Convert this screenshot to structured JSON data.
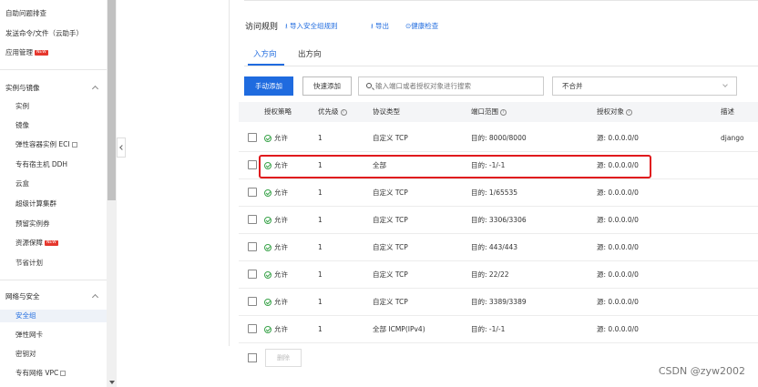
{
  "sidebar": {
    "items": [
      {
        "label": "自助问题排查"
      },
      {
        "label": "发送命令/文件（云助手）"
      },
      {
        "label": "应用管理",
        "badge": "NEW"
      }
    ],
    "groups": [
      {
        "label": "实例与镜像",
        "items": [
          {
            "label": "实例"
          },
          {
            "label": "镜像"
          },
          {
            "label": "弹性容器实例 ECI"
          },
          {
            "label": "专有宿主机 DDH"
          },
          {
            "label": "云盒"
          },
          {
            "label": "超级计算集群"
          },
          {
            "label": "预留实例券"
          },
          {
            "label": "资源保障",
            "badge": "NEW"
          },
          {
            "label": "节省计划"
          }
        ]
      },
      {
        "label": "网络与安全",
        "items": [
          {
            "label": "安全组"
          },
          {
            "label": "弹性网卡"
          },
          {
            "label": "密钥对"
          },
          {
            "label": "专有网络 VPC"
          }
        ]
      }
    ]
  },
  "header": {
    "title": "访问规则",
    "import_label": "导入安全组规则",
    "export_label": "导出",
    "health_label": "健康检查"
  },
  "tabs": [
    {
      "label": "入方向",
      "active": true
    },
    {
      "label": "出方向",
      "active": false
    }
  ],
  "toolbar": {
    "add_label": "手动添加",
    "quick_add_label": "快速添加",
    "search_placeholder": "输入端口或者授权对象进行搜索",
    "merge_value": "不合并"
  },
  "table": {
    "columns": [
      "授权策略",
      "优先级",
      "协议类型",
      "端口范围",
      "授权对象",
      "描述"
    ],
    "rows": [
      {
        "policy": "允许",
        "priority": "1",
        "protocol": "自定义 TCP",
        "port": "目的: 8000/8000",
        "source": "源: 0.0.0.0/0",
        "desc": "django"
      },
      {
        "policy": "允许",
        "priority": "1",
        "protocol": "全部",
        "port": "目的: -1/-1",
        "source": "源: 0.0.0.0/0",
        "desc": ""
      },
      {
        "policy": "允许",
        "priority": "1",
        "protocol": "自定义 TCP",
        "port": "目的: 1/65535",
        "source": "源: 0.0.0.0/0",
        "desc": ""
      },
      {
        "policy": "允许",
        "priority": "1",
        "protocol": "自定义 TCP",
        "port": "目的: 3306/3306",
        "source": "源: 0.0.0.0/0",
        "desc": ""
      },
      {
        "policy": "允许",
        "priority": "1",
        "protocol": "自定义 TCP",
        "port": "目的: 443/443",
        "source": "源: 0.0.0.0/0",
        "desc": ""
      },
      {
        "policy": "允许",
        "priority": "1",
        "protocol": "自定义 TCP",
        "port": "目的: 22/22",
        "source": "源: 0.0.0.0/0",
        "desc": ""
      },
      {
        "policy": "允许",
        "priority": "1",
        "protocol": "自定义 TCP",
        "port": "目的: 3389/3389",
        "source": "源: 0.0.0.0/0",
        "desc": ""
      },
      {
        "policy": "允许",
        "priority": "1",
        "protocol": "全部 ICMP(IPv4)",
        "port": "目的: -1/-1",
        "source": "源: 0.0.0.0/0",
        "desc": ""
      }
    ],
    "delete_label": "删除"
  },
  "watermark": "CSDN @zyw2002",
  "colors": {
    "accent": "#1f6bdf",
    "highlight": "#e0191d",
    "allow": "#3aa34a"
  }
}
